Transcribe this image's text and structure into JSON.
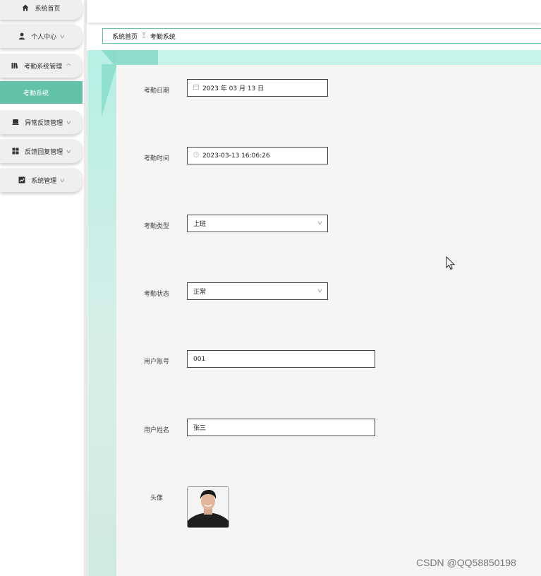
{
  "sidebar": {
    "items": [
      {
        "label": "系统首页",
        "icon": "home-icon",
        "has_chevron": false
      },
      {
        "label": "个人中心",
        "icon": "user-icon",
        "has_chevron": true
      },
      {
        "label": "考勤系统管理",
        "icon": "books-icon",
        "has_chevron": true,
        "expanded": true
      },
      {
        "label": "异常反馈管理",
        "icon": "box-icon",
        "has_chevron": true
      },
      {
        "label": "反馈回复管理",
        "icon": "grid-icon",
        "has_chevron": true
      },
      {
        "label": "系统管理",
        "icon": "chart-icon",
        "has_chevron": true
      }
    ],
    "active_sub": "考勤系统",
    "accent": "#62c3a9"
  },
  "breadcrumb": {
    "home": "系统首页",
    "separator": "Ξ",
    "current": "考勤系统"
  },
  "form": {
    "date": {
      "label": "考勤日期",
      "value": "2023 年 03 月 13 日",
      "icon": "calendar-icon"
    },
    "time": {
      "label": "考勤时间",
      "value": "2023-03-13 16:06:26",
      "icon": "clock-icon"
    },
    "type": {
      "label": "考勤类型",
      "value": "上班"
    },
    "status": {
      "label": "考勤状态",
      "value": "正常"
    },
    "account": {
      "label": "用户账号",
      "value": "001"
    },
    "name": {
      "label": "用户姓名",
      "value": "张三"
    },
    "avatar": {
      "label": "头像"
    }
  },
  "watermark": "CSDN @QQ58850198"
}
